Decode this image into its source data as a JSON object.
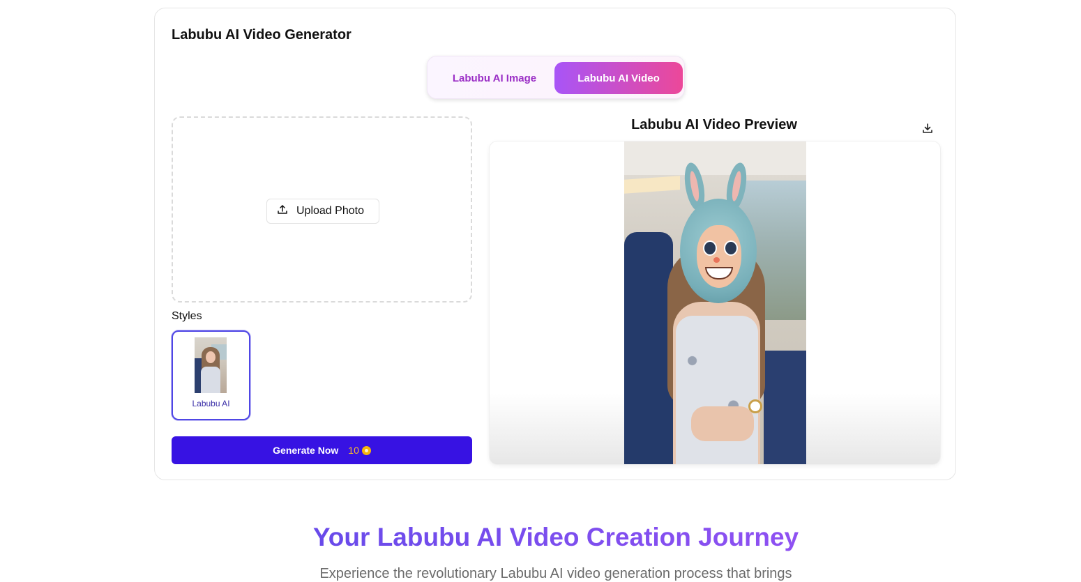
{
  "generator": {
    "title": "Labubu AI Video Generator",
    "tabs": {
      "image_label": "Labubu AI Image",
      "video_label": "Labubu AI Video",
      "active": "video"
    },
    "upload": {
      "button_label": "Upload Photo",
      "icon": "upload-icon"
    },
    "styles": {
      "label": "Styles",
      "items": [
        {
          "name": "Labubu AI",
          "selected": true
        }
      ]
    },
    "generate": {
      "label": "Generate Now",
      "cost": "10",
      "cost_icon": "coin-icon"
    },
    "preview": {
      "title": "Labubu AI Video Preview",
      "download_icon": "download-icon"
    }
  },
  "section": {
    "heading": "Your Labubu AI Video Creation Journey",
    "subheading": "Experience the revolutionary Labubu AI video generation process that brings"
  },
  "colors": {
    "primary_button": "#3712e3",
    "tab_active_gradient_start": "#a855f7",
    "tab_active_gradient_end": "#ec4899",
    "tab_inactive_text": "#9b2fc6",
    "heading_gradient_start": "#4f46e5",
    "heading_gradient_end": "#a855f7",
    "coin": "#f5b50a"
  }
}
